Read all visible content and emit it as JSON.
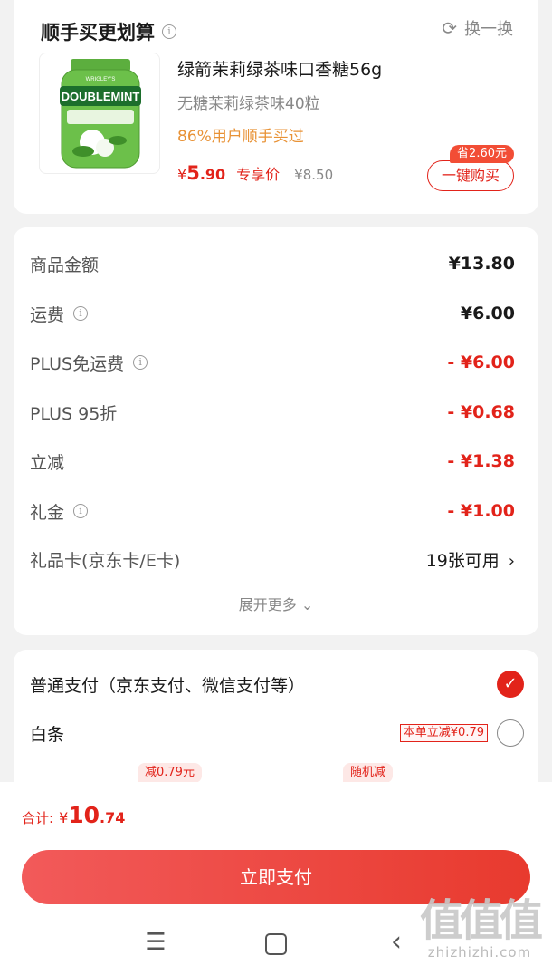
{
  "addon": {
    "title": "顺手买更划算",
    "refresh_label": "换一换",
    "product": {
      "name": "绿箭茉莉绿茶味口香糖56g",
      "subtitle": "无糖茉莉绿茶味40粒",
      "bought": "86%用户顺手买过",
      "price_symbol": "¥",
      "price_int": "5",
      "price_dec": ".90",
      "price_tag": "专享价",
      "original_price": "¥8.50",
      "save_badge": "省2.60元",
      "buy_label": "一键购买",
      "image_brand": "DOUBLEMINT",
      "image_maker": "WRIGLEY'S"
    }
  },
  "summary": {
    "rows": [
      {
        "label": "商品金额",
        "value": "¥13.80",
        "info": false,
        "red": false
      },
      {
        "label": "运费",
        "value": "¥6.00",
        "info": true,
        "red": false
      },
      {
        "label": "PLUS免运费",
        "value": "- ¥6.00",
        "info": true,
        "red": true
      },
      {
        "label": "PLUS 95折",
        "value": "- ¥0.68",
        "info": false,
        "red": true
      },
      {
        "label": "立减",
        "value": "- ¥1.38",
        "info": false,
        "red": true
      },
      {
        "label": "礼金",
        "value": "- ¥1.00",
        "info": true,
        "red": true
      }
    ],
    "gift_card": {
      "label": "礼品卡(京东卡/E卡)",
      "value": "19张可用"
    },
    "expand_label": "展开更多"
  },
  "payment": {
    "normal": {
      "label": "普通支付（京东支付、微信支付等）",
      "selected": true
    },
    "baitiao": {
      "label": "白条",
      "promo": "本单立减¥0.79",
      "selected": false
    },
    "chip_tags": [
      "减0.79元",
      "随机减"
    ]
  },
  "footer": {
    "total_label": "合计:",
    "total_symbol": "¥",
    "total_int": "10",
    "total_dec": ".74",
    "pay_label": "立即支付"
  },
  "watermark": {
    "text": "值值值",
    "domain": "zhizhizhi.com"
  },
  "colors": {
    "accent": "#e2231a",
    "orange": "#e89236",
    "gray": "#888888"
  }
}
